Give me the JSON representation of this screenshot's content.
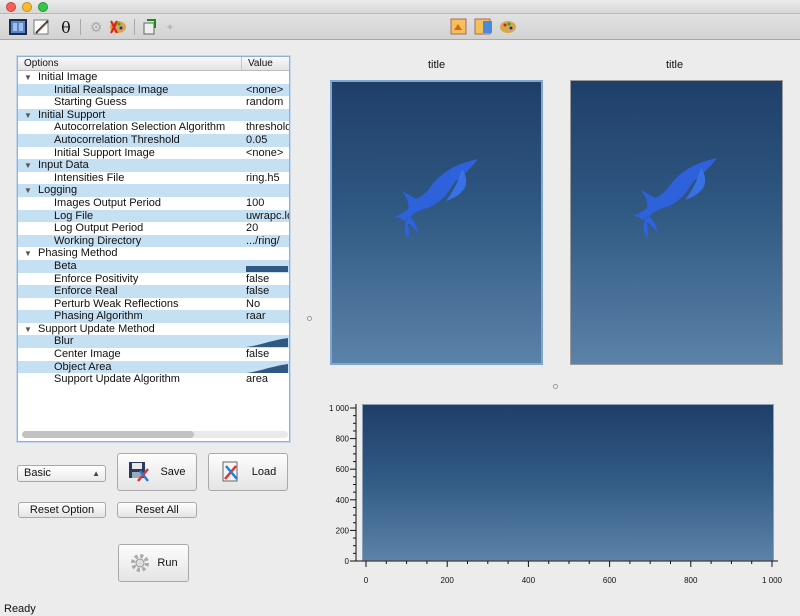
{
  "tree": {
    "headers": {
      "options": "Options",
      "value": "Value"
    },
    "rows": [
      {
        "name": "Initial Image",
        "value": "",
        "group": true
      },
      {
        "name": "Initial Realspace Image",
        "value": "<none>"
      },
      {
        "name": "Starting Guess",
        "value": "random"
      },
      {
        "name": "Initial Support",
        "value": "",
        "group": true
      },
      {
        "name": "Autocorrelation Selection Algorithm",
        "value": "threshold"
      },
      {
        "name": "Autocorrelation Threshold",
        "value": "0.05"
      },
      {
        "name": "Initial Support Image",
        "value": "<none>"
      },
      {
        "name": "Input Data",
        "value": "",
        "group": true
      },
      {
        "name": "Intensities File",
        "value": "ring.h5"
      },
      {
        "name": "Logging",
        "value": "",
        "group": true
      },
      {
        "name": "Images Output Period",
        "value": "100"
      },
      {
        "name": "Log File",
        "value": "uwrapc.log"
      },
      {
        "name": "Log Output Period",
        "value": "20"
      },
      {
        "name": "Working Directory",
        "value": ".../ring/"
      },
      {
        "name": "Phasing Method",
        "value": "",
        "group": true
      },
      {
        "name": "Beta",
        "value": "",
        "ramp": "flat"
      },
      {
        "name": "Enforce Positivity",
        "value": "false"
      },
      {
        "name": "Enforce Real",
        "value": "false"
      },
      {
        "name": "Perturb Weak Reflections",
        "value": "No"
      },
      {
        "name": "Phasing Algorithm",
        "value": "raar"
      },
      {
        "name": "Support Update Method",
        "value": "",
        "group": true
      },
      {
        "name": "Blur",
        "value": "",
        "ramp": "curve"
      },
      {
        "name": "Center Image",
        "value": "false"
      },
      {
        "name": "Object Area",
        "value": "",
        "ramp": "curve"
      },
      {
        "name": "Support Update Algorithm",
        "value": "area"
      }
    ]
  },
  "controls": {
    "mode_selected": "Basic",
    "save_label": "Save",
    "load_label": "Load",
    "reset_option_label": "Reset Option",
    "reset_all_label": "Reset All",
    "run_label": "Run"
  },
  "images": {
    "left_title": "title",
    "right_title": "title"
  },
  "plot": {
    "y_ticks": [
      "1 000",
      "800",
      "600",
      "400",
      "200",
      "0"
    ],
    "x_ticks": [
      "0",
      "200",
      "400",
      "600",
      "800",
      "1 000"
    ]
  },
  "chart_data": {
    "type": "line",
    "series": [],
    "xlim": [
      0,
      1000
    ],
    "ylim": [
      0,
      1000
    ],
    "x_ticks": [
      0,
      200,
      400,
      600,
      800,
      1000
    ],
    "y_ticks": [
      0,
      200,
      400,
      600,
      800,
      1000
    ]
  },
  "status": {
    "text": "Ready"
  },
  "colors": {
    "accent": "#7fa6d2",
    "row_alt": "#c5dff3",
    "image_top": "#1f3f69",
    "image_bottom": "#5b82a8",
    "bird": "#2e62e0"
  }
}
